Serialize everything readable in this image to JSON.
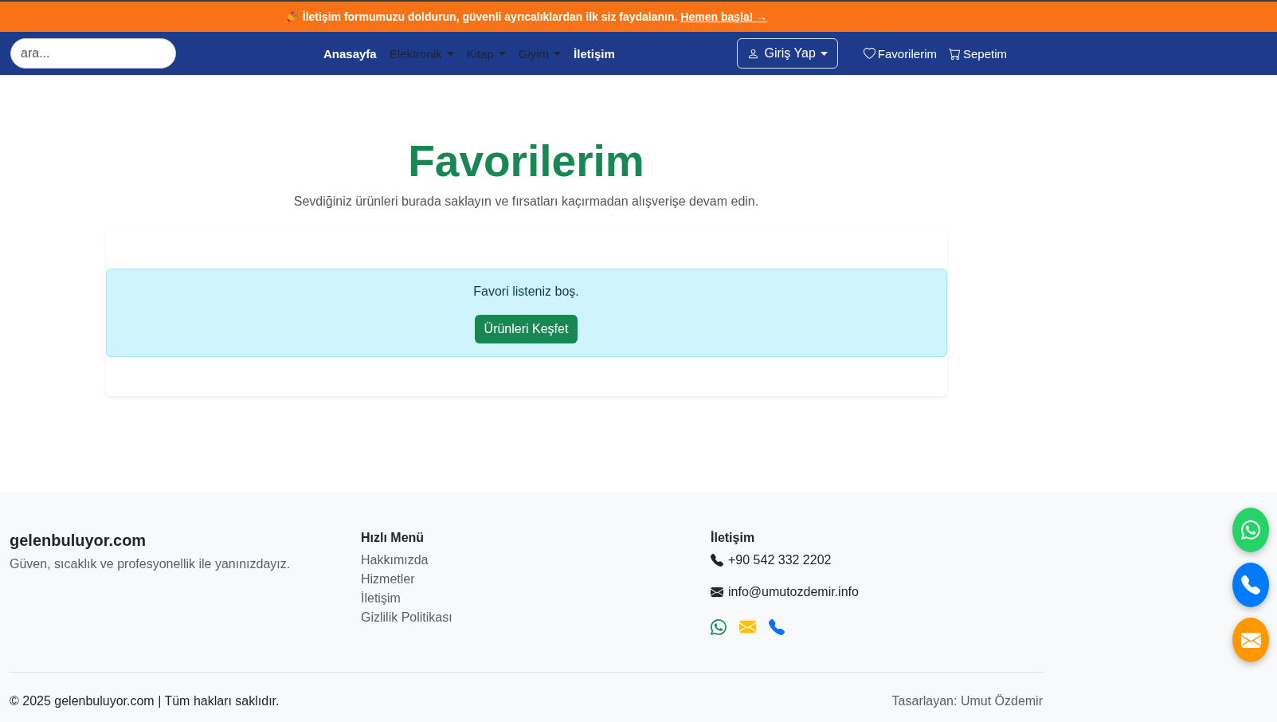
{
  "promo_banner": {
    "text": "İletişim formumuzu doldurun, güvenli ayrıcalıklardan ilk siz faydalanın.",
    "link": "Hemen başla! →"
  },
  "navbar": {
    "search": {
      "placeholder": "ara..."
    },
    "links": [
      {
        "label": "Anasayfa",
        "kind": "link"
      },
      {
        "label": "Elektronik",
        "kind": "dropdown"
      },
      {
        "label": "Kitap",
        "kind": "dropdown"
      },
      {
        "label": "Giyim",
        "kind": "dropdown"
      },
      {
        "label": "İletişim",
        "kind": "link"
      }
    ],
    "login_button": {
      "label": "Giriş Yap"
    },
    "account_links": [
      {
        "label": "Favorilerim",
        "kind": "favorites"
      },
      {
        "label": "Sepetim",
        "kind": "cart"
      }
    ]
  },
  "page_header": {
    "title": "Favorilerim",
    "subtitle": "Sevdiğiniz ürünleri burada saklayın ve fırsatları kaçırmadan alışverişe devam edin."
  },
  "empty_state": {
    "message": "Favori listeniz boş.",
    "button": "Ürünleri Keşfet"
  },
  "footer": {
    "brand": {
      "name": "gelenbuluyor.com",
      "tagline": "Güven, sıcaklık ve profesyonellik ile yanınızdayız."
    },
    "quick_menu": {
      "title": "Hızlı Menü",
      "links": [
        "Hakkımızda",
        "Hizmetler",
        "İletişim",
        "Gizlilik Politikası"
      ]
    },
    "contact": {
      "title": "İletişim",
      "items": [
        {
          "kind": "phone",
          "text": "+90 542 332 2202"
        },
        {
          "kind": "email",
          "text": "info@umutozdemir.info"
        }
      ],
      "social": [
        {
          "kind": "whatsapp"
        },
        {
          "kind": "email"
        },
        {
          "kind": "phone"
        }
      ]
    },
    "copyright": "© 2025 gelenbuluyor.com | Tüm hakları saklıdır.",
    "credit": "Tasarlayan: Umut Özdemir"
  },
  "floating_buttons": [
    {
      "kind": "whatsapp"
    },
    {
      "kind": "phone"
    },
    {
      "kind": "email"
    }
  ]
}
